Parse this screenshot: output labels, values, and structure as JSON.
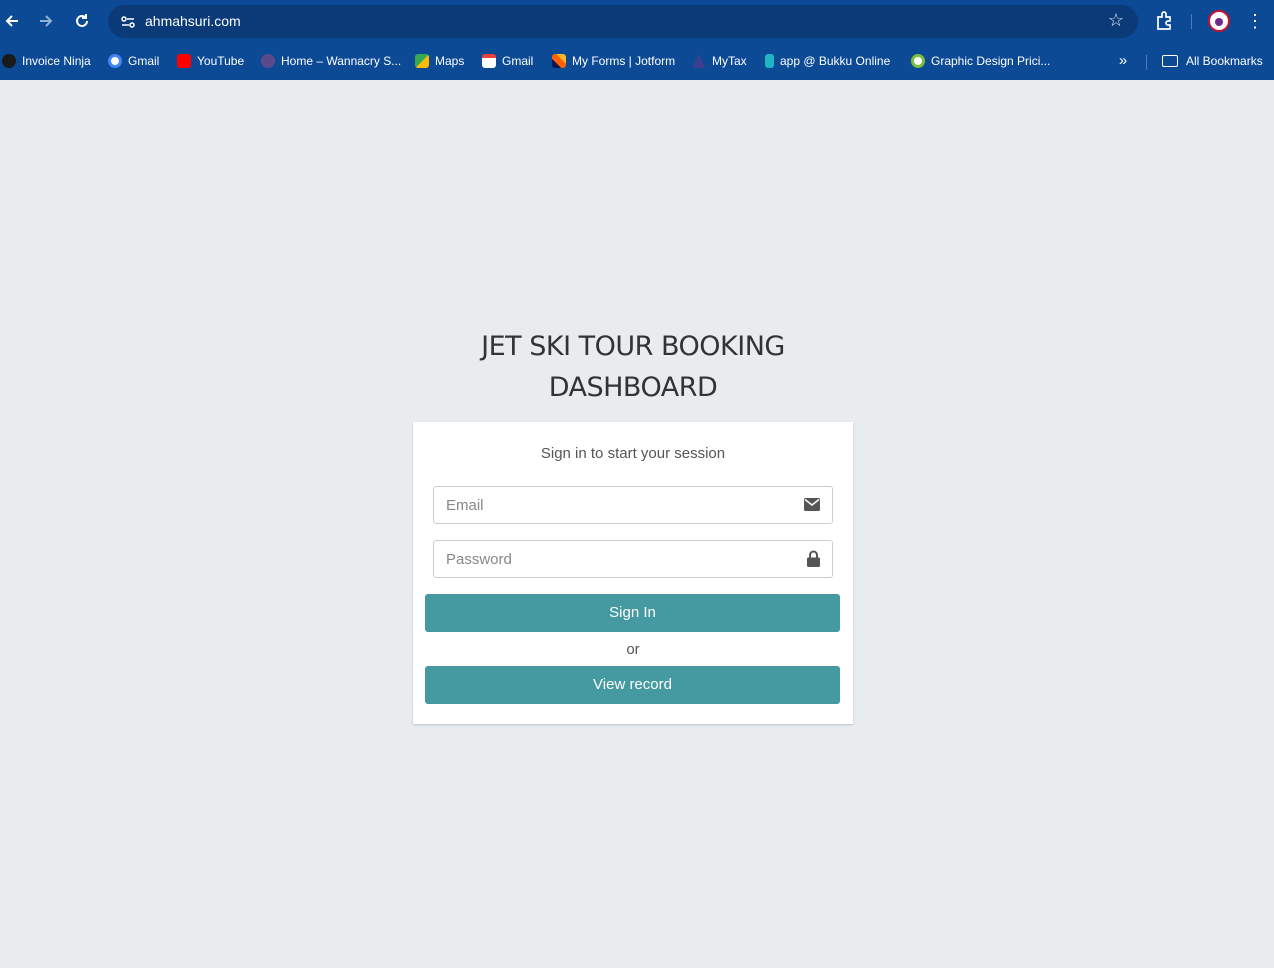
{
  "browser": {
    "url": "ahmahsuri.com",
    "bookmarks": [
      {
        "label": "Invoice Ninja",
        "color": "#1a1a1a"
      },
      {
        "label": "Gmail",
        "color": "#4285f4"
      },
      {
        "label": "YouTube",
        "color": "#ff0000"
      },
      {
        "label": "Home – Wannacry S...",
        "color": "#5b4a8a"
      },
      {
        "label": "Maps",
        "color": "#34a853"
      },
      {
        "label": "Gmail",
        "color": "#ea4335"
      },
      {
        "label": "My Forms | Jotform",
        "color": "#ff6100"
      },
      {
        "label": "MyTax",
        "color": "#3b3f8f"
      },
      {
        "label": "app @ Bukku Online",
        "color": "#1fb5c4"
      },
      {
        "label": "Graphic Design Prici...",
        "color": "#7cbf3a"
      }
    ],
    "all_bookmarks_label": "All Bookmarks"
  },
  "login": {
    "title_line1": "JET SKI TOUR BOOKING",
    "title_line2": "DASHBOARD",
    "message": "Sign in to start your session",
    "email_placeholder": "Email",
    "password_placeholder": "Password",
    "sign_in_label": "Sign In",
    "or_label": "or",
    "view_record_label": "View record",
    "accent_color": "#449aa0"
  }
}
